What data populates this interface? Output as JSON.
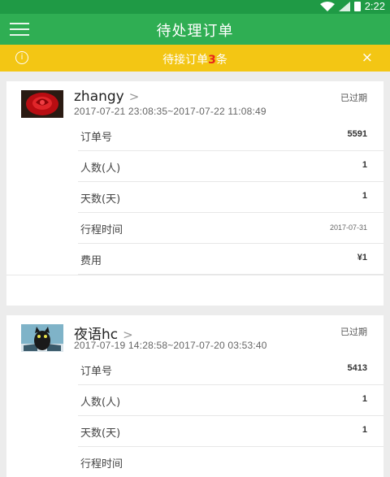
{
  "status_bar": {
    "time": "2:22"
  },
  "app_bar": {
    "title": "待处理订单"
  },
  "notice": {
    "prefix": "待接订单",
    "count": "3",
    "suffix": "条",
    "close": "×",
    "info": "i"
  },
  "orders": [
    {
      "name": "zhangy",
      "chevron": ">",
      "time_range": "2017-07-21 23:08:35~2017-07-22 11:08:49",
      "state": "已过期",
      "fields": [
        {
          "label": "订单号",
          "value": "5591"
        },
        {
          "label": "人数(人)",
          "value": "1"
        },
        {
          "label": "天数(天)",
          "value": "1"
        },
        {
          "label": "行程时间",
          "value": "2017-07-31"
        },
        {
          "label": "费用",
          "value": "¥1"
        }
      ]
    },
    {
      "name": "夜语hc",
      "chevron": ">",
      "time_range": "2017-07-19 14:28:58~2017-07-20 03:53:40",
      "state": "已过期",
      "fields": [
        {
          "label": "订单号",
          "value": "5413"
        },
        {
          "label": "人数(人)",
          "value": "1"
        },
        {
          "label": "天数(天)",
          "value": "1"
        },
        {
          "label": "行程时间",
          "value": ""
        }
      ]
    }
  ]
}
